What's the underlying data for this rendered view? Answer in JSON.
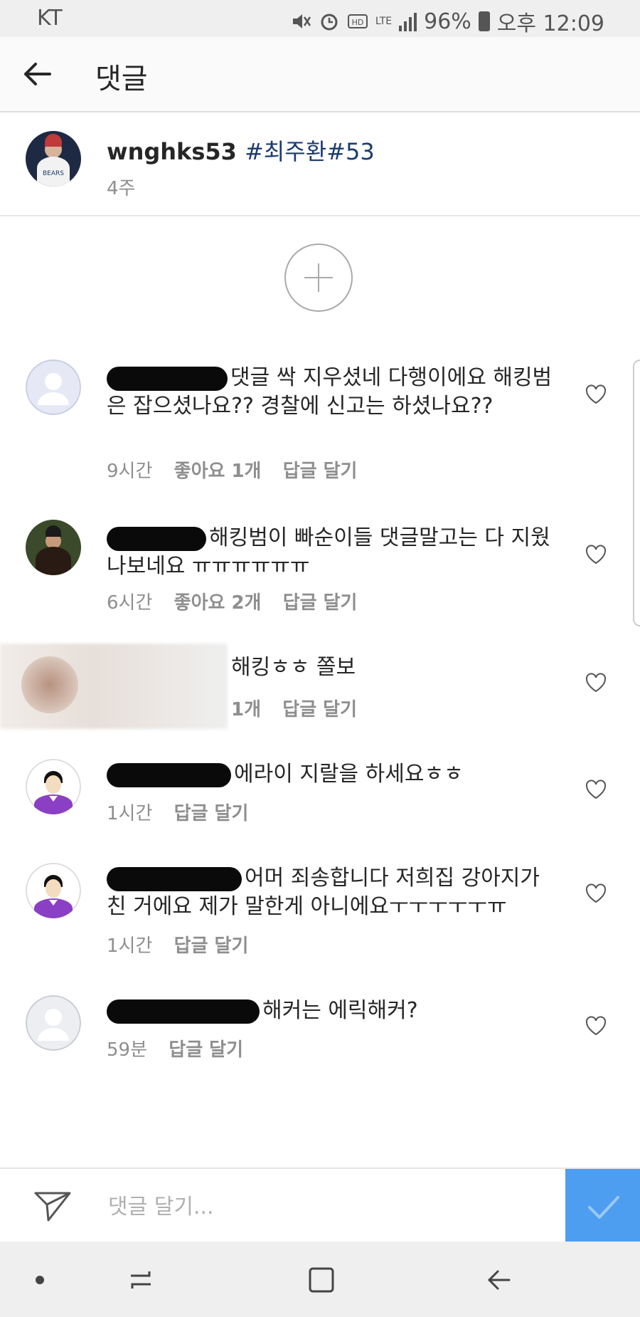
{
  "status_bar": {
    "carrier": "KT",
    "network": "LTE",
    "battery": "96%",
    "time": "오후 12:09"
  },
  "header": {
    "title": "댓글",
    "back_icon": "arrow-left-icon"
  },
  "post": {
    "username": "wnghks53",
    "caption": "#최주환#53",
    "time": "4주"
  },
  "load_more_icon": "plus-circle-icon",
  "comments": [
    {
      "text": "댓글 싹 지우셨네 다행이에요 해킹범은 잡으셨나요?? 경찰에 신고는 하셨나요??",
      "time": "9시간",
      "likes": "좋아요 1개",
      "reply": "답글 달기"
    },
    {
      "text": "해킹범이 빠순이들 댓글말고는 다 지웠나보네요 ㅠㅠㅠㅠㅠㅠ",
      "time": "6시간",
      "likes": "좋아요 2개",
      "reply": "답글 달기"
    },
    {
      "text": "해킹ㅎㅎ 쫄보",
      "time": "1개",
      "reply": "답글 달기"
    },
    {
      "text": "에라이 지랄을 하세요ㅎㅎ",
      "time": "1시간",
      "reply": "답글 달기"
    },
    {
      "text": "어머 죄송합니다 저희집 강아지가 친 거에요 제가 말한게 아니에요ㅜㅜㅜㅜㅜㅠ",
      "time": "1시간",
      "reply": "답글 달기"
    },
    {
      "text": "해커는 에릭해커?",
      "time": "59분",
      "reply": "답글 달기"
    }
  ],
  "input_bar": {
    "placeholder": "댓글 달기...",
    "send_icon": "paper-plane-icon",
    "submit_icon": "checkmark-icon",
    "submit_color": "#4d9ef0"
  },
  "nav_bar": {
    "icons": [
      "dot-icon",
      "recent-apps-icon",
      "home-icon",
      "back-icon"
    ]
  }
}
